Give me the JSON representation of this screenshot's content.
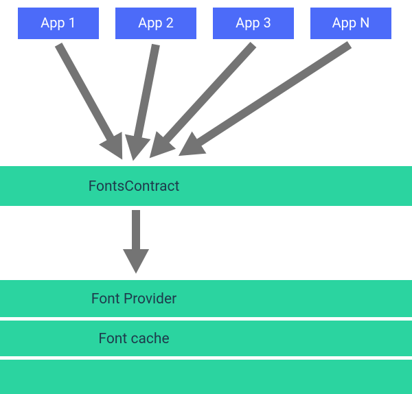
{
  "colors": {
    "apps": "#4c6bf9",
    "layer": "#2bd4a0",
    "arrow": "#747474",
    "background": "#ffffff",
    "text_light": "#ffffff",
    "text_dark": "#1e3a4c"
  },
  "apps": [
    {
      "label": "App 1"
    },
    {
      "label": "App 2"
    },
    {
      "label": "App 3"
    },
    {
      "label": "App N"
    }
  ],
  "layers": {
    "contract": "FontsContract",
    "provider": "Font Provider",
    "cache": "Font cache"
  },
  "chart_data": {
    "type": "diagram",
    "title": "",
    "description": "Four application boxes (App 1, App 2, App 3, App N) each send a request down to a single FontsContract layer, which in turn sends down to a Font Provider layer that sits on top of a Font cache layer.",
    "nodes": [
      {
        "id": "app1",
        "label": "App 1"
      },
      {
        "id": "app2",
        "label": "App 2"
      },
      {
        "id": "app3",
        "label": "App 3"
      },
      {
        "id": "appN",
        "label": "App N"
      },
      {
        "id": "contract",
        "label": "FontsContract"
      },
      {
        "id": "provider",
        "label": "Font Provider"
      },
      {
        "id": "cache",
        "label": "Font cache"
      }
    ],
    "edges": [
      {
        "from": "app1",
        "to": "contract"
      },
      {
        "from": "app2",
        "to": "contract"
      },
      {
        "from": "app3",
        "to": "contract"
      },
      {
        "from": "appN",
        "to": "contract"
      },
      {
        "from": "contract",
        "to": "provider"
      }
    ]
  }
}
